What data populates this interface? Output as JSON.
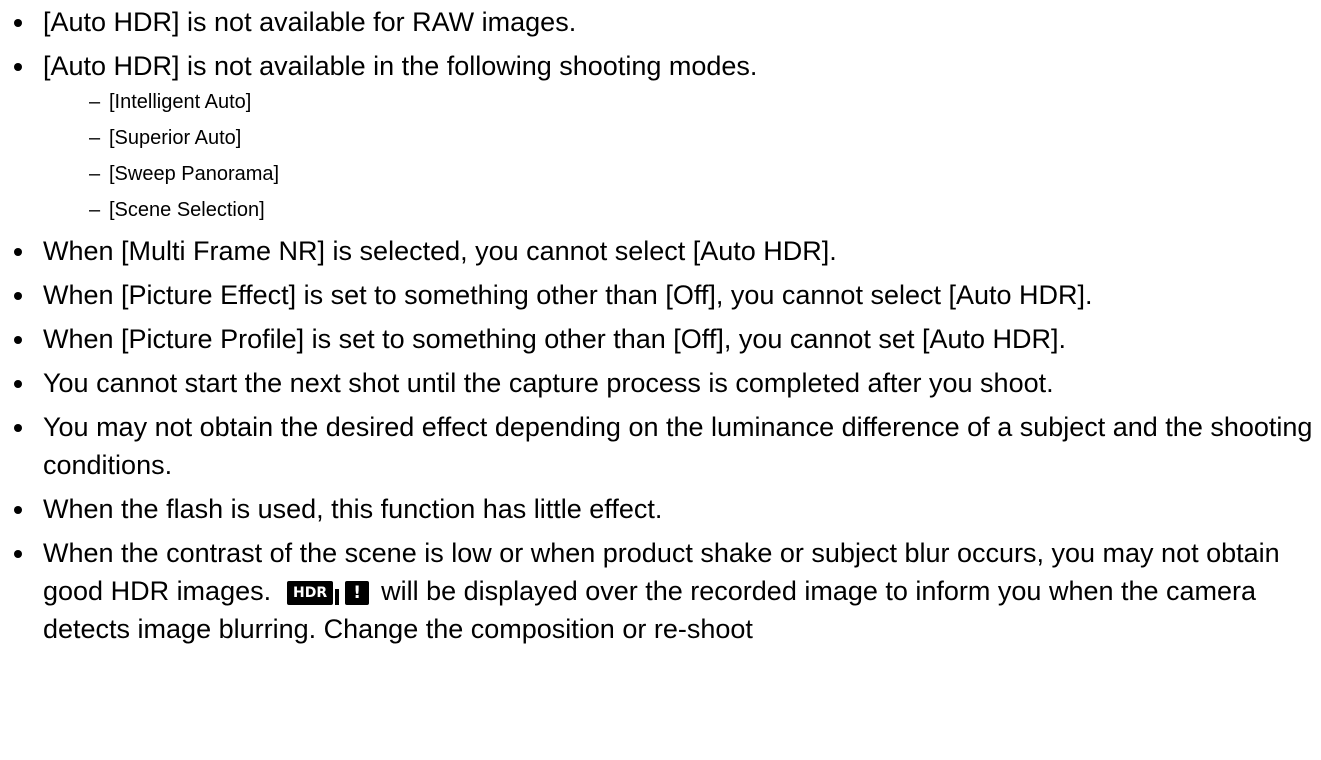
{
  "notes": [
    "[Auto HDR] is not available for RAW images.",
    "[Auto HDR] is not available in the following shooting modes.",
    "When [Multi Frame NR] is selected, you cannot select [Auto HDR].",
    "When [Picture Effect] is set to something other than [Off], you cannot select [Auto HDR].",
    "When [Picture Profile] is set to something other than [Off], you cannot set [Auto HDR].",
    "You cannot start the next shot until the capture process is completed after you shoot.",
    "You may not obtain the desired effect depending on the luminance difference of a subject and the shooting conditions.",
    "When the flash is used, this function has little effect."
  ],
  "modes": [
    "[Intelligent Auto]",
    "[Superior Auto]",
    "[Sweep Panorama]",
    "[Scene Selection]"
  ],
  "last_note": {
    "before_icon": "When the contrast of the scene is low or when product shake or subject blur occurs, you may not obtain good HDR images.",
    "after_icon": "will be displayed over the recorded image to inform you when the camera detects image blurring. Change the composition or re-shoot"
  },
  "icons": {
    "hdr_badge": "HDR",
    "warning_badge": "!"
  }
}
